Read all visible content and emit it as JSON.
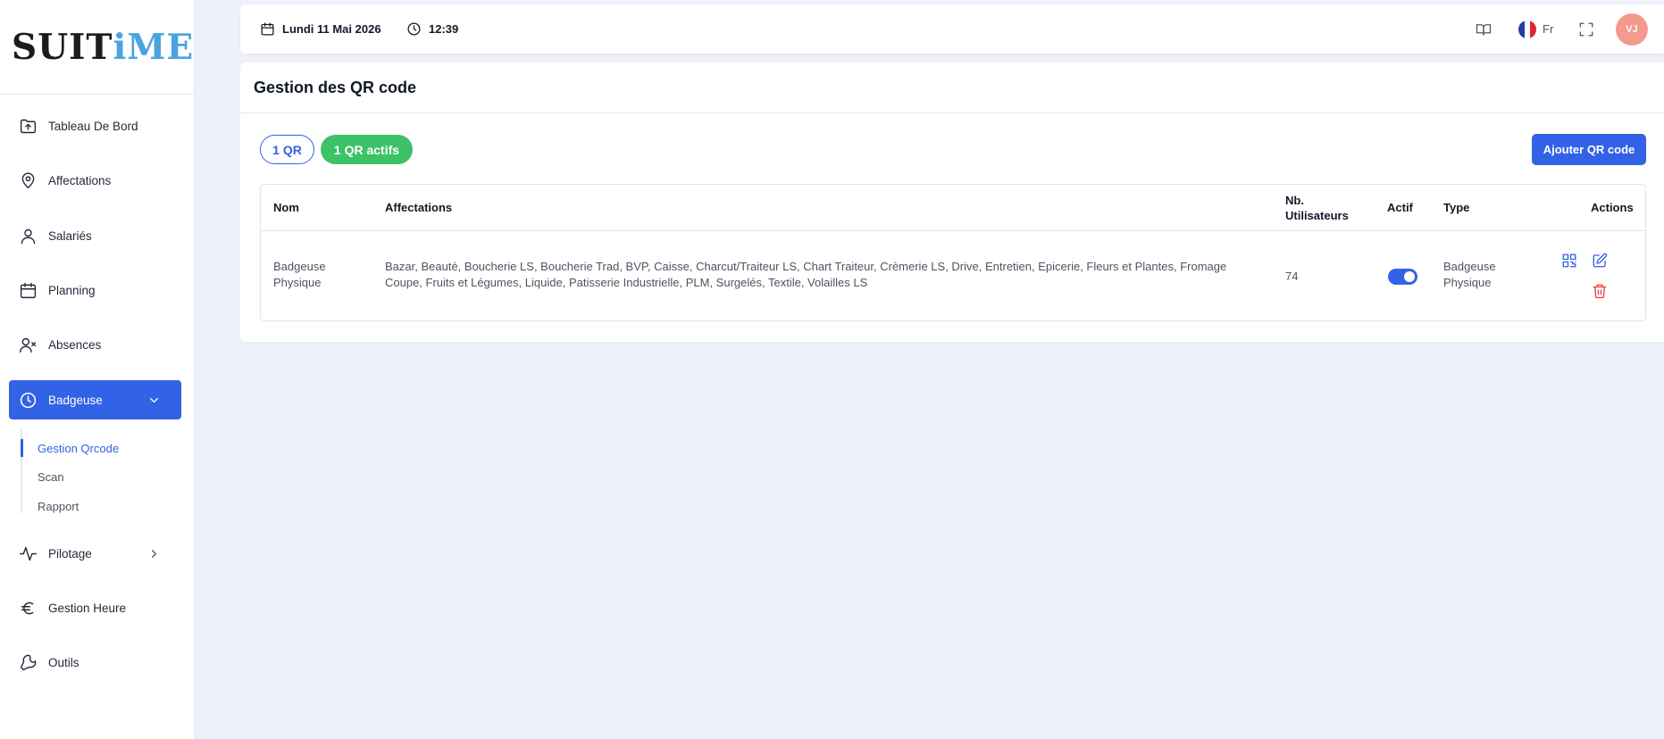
{
  "brand": {
    "part1": "SUIT",
    "part2": "i",
    "part3": "ME"
  },
  "sidebar": {
    "items": [
      {
        "label": "Tableau De Bord",
        "icon": "folder-upload-icon"
      },
      {
        "label": "Affectations",
        "icon": "map-pin-icon"
      },
      {
        "label": "Salariés",
        "icon": "user-icon"
      },
      {
        "label": "Planning",
        "icon": "calendar-icon"
      },
      {
        "label": "Absences",
        "icon": "user-x-icon"
      },
      {
        "label": "Badgeuse",
        "icon": "clock-icon",
        "active": true,
        "expanded": true
      },
      {
        "label": "Pilotage",
        "icon": "activity-icon"
      },
      {
        "label": "Gestion Heure",
        "icon": "euro-icon"
      },
      {
        "label": "Outils",
        "icon": "wrench-icon"
      }
    ],
    "badgeuse_sub": [
      {
        "label": "Gestion Qrcode",
        "active": true
      },
      {
        "label": "Scan"
      },
      {
        "label": "Rapport"
      }
    ]
  },
  "header": {
    "date": "Lundi 11 Mai 2026",
    "time": "12:39",
    "language": "Fr",
    "avatar_initials": "VJ"
  },
  "page": {
    "title": "Gestion des QR code",
    "count_pill": "1 QR",
    "active_pill": "1 QR actifs",
    "add_button": "Ajouter QR code"
  },
  "table": {
    "columns": {
      "nom": "Nom",
      "affectations": "Affectations",
      "nb_line1": "Nb.",
      "nb_line2": "Utilisateurs",
      "actif": "Actif",
      "type": "Type",
      "actions": "Actions"
    },
    "rows": [
      {
        "nom_line1": "Badgeuse",
        "nom_line2": "Physique",
        "affectations_line1": "Bazar, Beauté, Boucherie LS, Boucherie Trad, BVP, Caisse, Charcut/Traiteur LS, Chart Traiteur, Crèmerie LS, Drive, Entretien, Epicerie, Fleurs et Plantes, Fromage",
        "affectations_line2": "Coupe, Fruits et Légumes, Liquide, Patisserie Industrielle, PLM, Surgelés, Textile, Volailles LS",
        "nb_utilisateurs": "74",
        "actif": true,
        "type_line1": "Badgeuse",
        "type_line2": "Physique"
      }
    ]
  },
  "colors": {
    "primary": "#3262e6",
    "success": "#3dc267",
    "danger": "#e53e3e",
    "avatar": "#f49a8c",
    "background": "#eef1f9"
  }
}
